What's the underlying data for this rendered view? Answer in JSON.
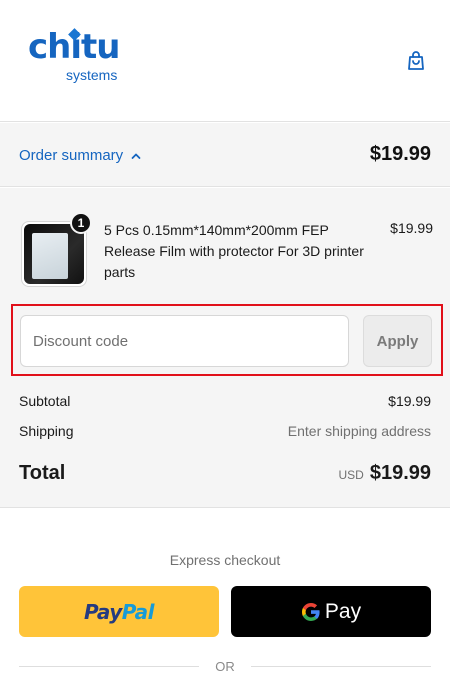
{
  "brand": {
    "name": "chitu",
    "tagline": "systems",
    "color": "#1565c0"
  },
  "header": {
    "cart_icon": "shopping-bag-icon"
  },
  "summary": {
    "toggle_label": "Order summary",
    "toggle_icon": "chevron-up-icon",
    "total": "$19.99"
  },
  "cart": {
    "items": [
      {
        "quantity": "1",
        "title": "5 Pcs 0.15mm*140mm*200mm FEP Release Film with protector For 3D printer parts",
        "price": "$19.99"
      }
    ]
  },
  "discount": {
    "placeholder": "Discount code",
    "value": "",
    "apply_label": "Apply",
    "highlight_color": "#e1101a"
  },
  "totals": {
    "subtotal_label": "Subtotal",
    "subtotal_value": "$19.99",
    "shipping_label": "Shipping",
    "shipping_value": "Enter shipping address",
    "total_label": "Total",
    "currency": "USD",
    "total_value": "$19.99"
  },
  "express": {
    "label": "Express checkout",
    "paypal_part1": "Pay",
    "paypal_part2": "Pal",
    "paypal_color": "#ffc439",
    "gpay_label": "Pay",
    "gpay_color": "#000000",
    "or_label": "OR"
  }
}
